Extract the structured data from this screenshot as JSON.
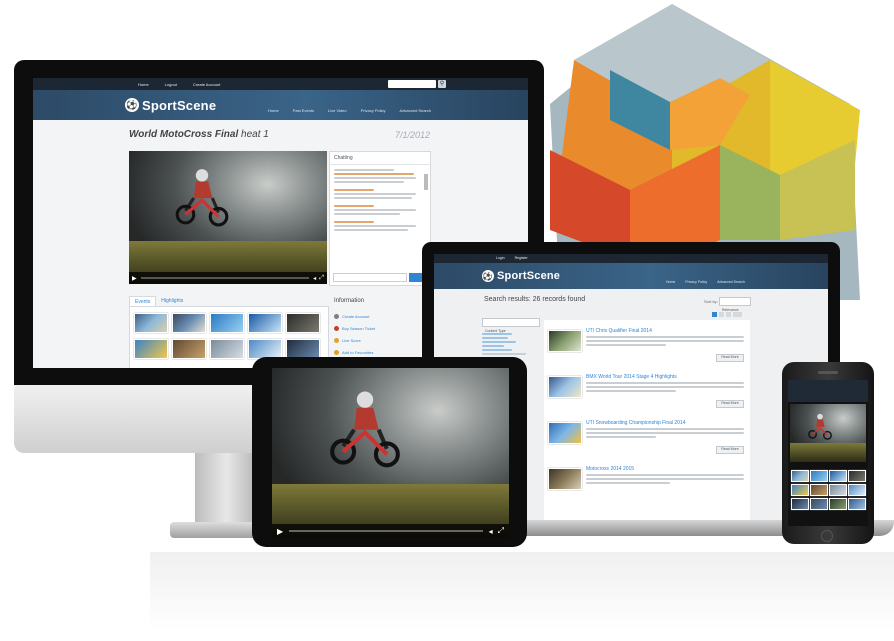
{
  "brand": {
    "name": "SportScene"
  },
  "desktop": {
    "topbar": {
      "links": [
        "Home",
        "Logout",
        "Create Account"
      ],
      "search_placeholder": "Search..."
    },
    "nav": [
      "Home",
      "Past Events",
      "Live Video",
      "Privacy Policy",
      "Advanced Search"
    ],
    "page_title_bold": "World MotoCross Final",
    "page_title_rest": " heat 1",
    "date": "7/1/2012",
    "chat_title": "Chatting",
    "tabs": [
      "Events",
      "Highlights"
    ],
    "info_title": "Information",
    "info_links": [
      "Create Account",
      "Buy Season Ticket",
      "Live Score",
      "Add to Favourites"
    ]
  },
  "laptop": {
    "topbar": {
      "links": [
        "Login",
        "Register"
      ]
    },
    "nav": [
      "Home",
      "Privacy Policy",
      "Advanced Search"
    ],
    "results_heading": "Search results: 26 records found",
    "sort_label": "Sort by:",
    "sort_value": "Relevance",
    "filter_title": "Content Type",
    "results": [
      {
        "title": "UTI Chris Qualifier Final 2014",
        "more": "Read More"
      },
      {
        "title": "BMX World Tour 2014 Stage 4 Highlights",
        "more": "Read More"
      },
      {
        "title": "UTI Snowboarding Championship Final 2014",
        "more": "Read More"
      },
      {
        "title": "Motocross 2014 2015",
        "more": "Read More"
      }
    ]
  },
  "colors": {
    "header_blue": "#2d4a66",
    "accent_blue": "#2e86d4",
    "hex_gray": "#9bb0b8",
    "hex_teal": "#4f8aa0",
    "hex_yellow": "#e3c92f",
    "hex_orange": "#e8762a",
    "hex_red": "#d04326",
    "hex_green": "#8aa55a"
  }
}
